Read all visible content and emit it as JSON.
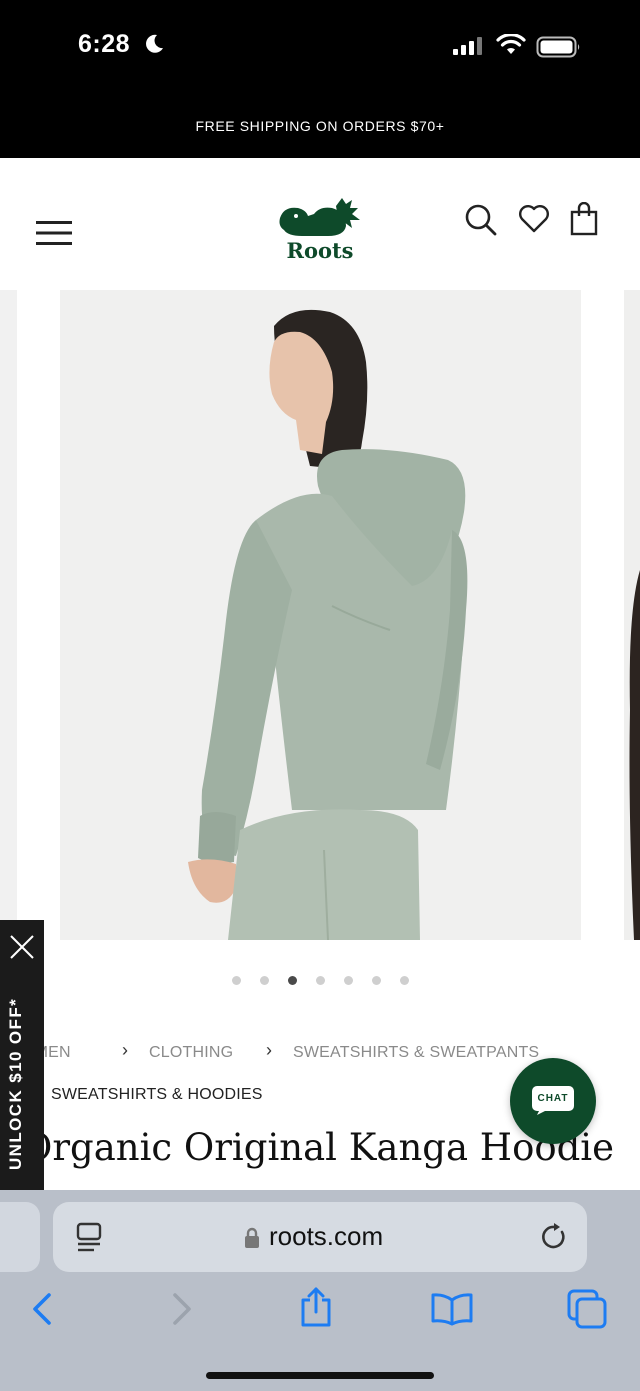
{
  "status_bar": {
    "time": "6:28"
  },
  "promo": {
    "text": "FREE SHIPPING ON ORDERS $70+"
  },
  "header": {
    "logo_text": "Roots"
  },
  "carousel": {
    "dot_count": 7,
    "active_index": 2
  },
  "breadcrumbs": {
    "items": [
      "WOMEN",
      "CLOTHING",
      "SWEATSHIRTS & SWEATPANTS",
      "SWEATSHIRTS & HOODIES"
    ],
    "visible_first": "OMEN"
  },
  "product": {
    "title": "Organic Original Kanga Hoodie"
  },
  "unlock_tab": {
    "text": "UNLOCK $10 OFF*"
  },
  "chat": {
    "label": "CHAT"
  },
  "browser": {
    "url": "roots.com"
  },
  "colors": {
    "brand_green": "#0e4a2a",
    "hoodie_sage": "#a9b8ab",
    "toolbar_blue": "#1d7cf2"
  },
  "icons": [
    "moon-icon",
    "signal-icon",
    "wifi-icon",
    "battery-icon",
    "menu-icon",
    "search-icon",
    "heart-icon",
    "bag-icon",
    "close-icon",
    "chat-icon",
    "reader-icon",
    "lock-icon",
    "reload-icon",
    "back-icon",
    "forward-icon",
    "share-icon",
    "bookmarks-icon",
    "tabs-icon"
  ]
}
